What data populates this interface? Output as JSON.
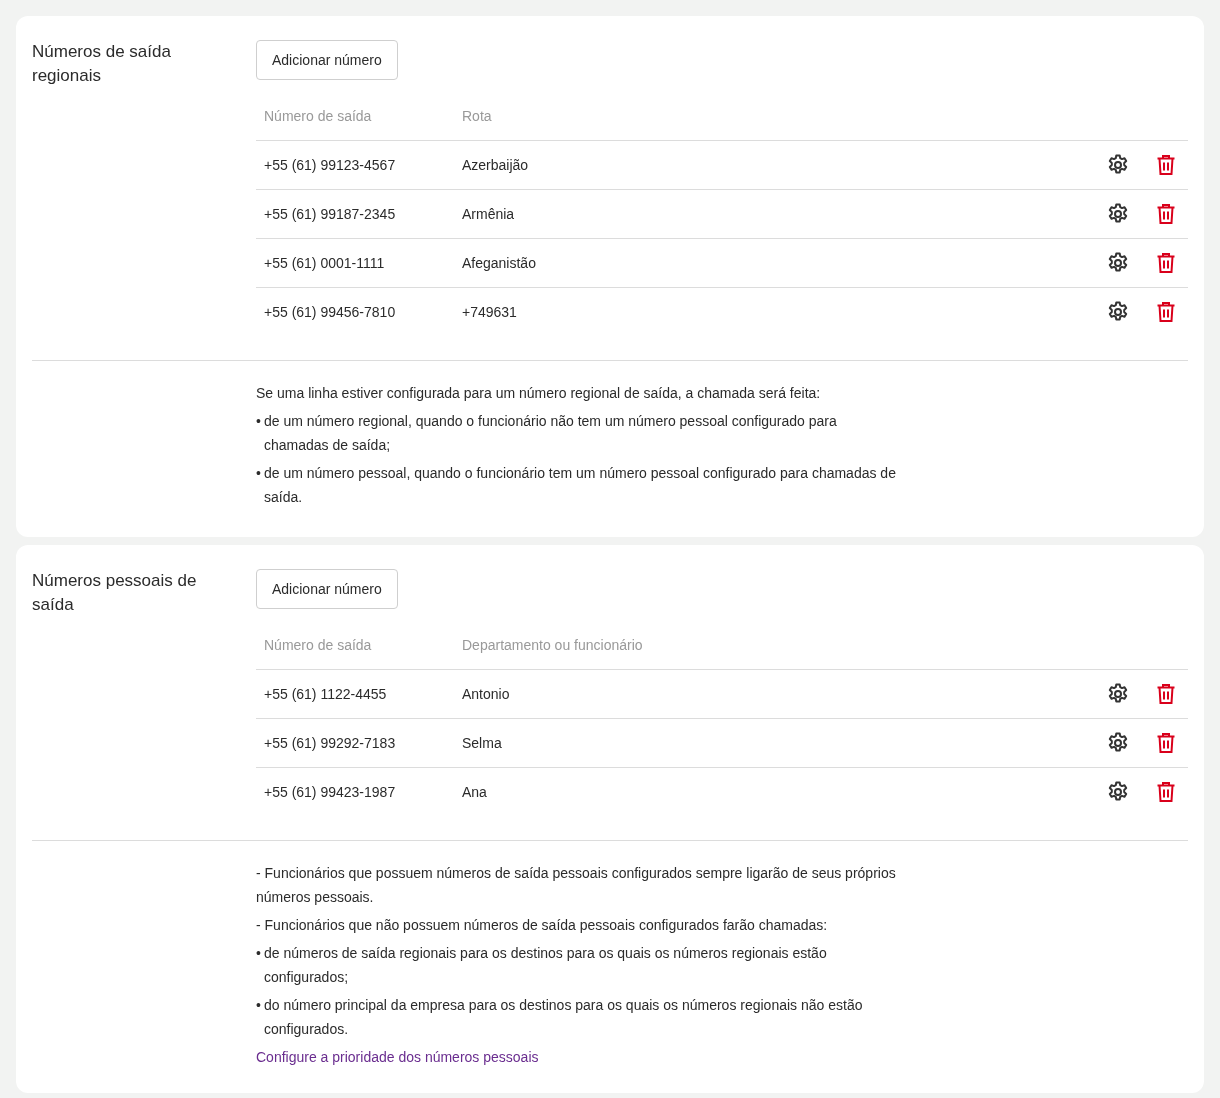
{
  "sections": [
    {
      "title": "Números de saída regionais",
      "add_button": "Adicionar número",
      "table": {
        "columns": [
          "Número de saída",
          "Rota"
        ],
        "rows": [
          {
            "number": "+55 (61) 99123-4567",
            "target": "Azerbaijão"
          },
          {
            "number": "+55 (61) 99187-2345",
            "target": "Armênia"
          },
          {
            "number": "+55 (61) 0001-1111",
            "target": "Afeganistão"
          },
          {
            "number": "+55 (61) 99456-7810",
            "target": "+749631"
          }
        ]
      },
      "notes": [
        {
          "kind": "para",
          "text": "Se uma linha estiver configurada para um número regional de saída, a chamada será feita:"
        },
        {
          "kind": "bullet",
          "marker": "•",
          "text": "de um número regional, quando o funcionário não tem um número pessoal configurado para chamadas de saída;"
        },
        {
          "kind": "bullet",
          "marker": "•",
          "text": "de um número pessoal, quando o funcionário tem um número pessoal configurado para chamadas de saída."
        }
      ]
    },
    {
      "title": "Números pessoais de saída",
      "add_button": "Adicionar número",
      "table": {
        "columns": [
          "Número de saída",
          "Departamento ou funcionário"
        ],
        "rows": [
          {
            "number": "+55 (61) 1122-4455",
            "target": "Antonio"
          },
          {
            "number": "+55 (61) 99292-7183",
            "target": "Selma"
          },
          {
            "number": "+55 (61) 99423-1987",
            "target": "Ana"
          }
        ]
      },
      "notes": [
        {
          "kind": "para",
          "text": "- Funcionários que possuem números de saída pessoais configurados sempre ligarão de seus próprios números pessoais."
        },
        {
          "kind": "para",
          "text": "- Funcionários que não possuem números de saída pessoais configurados farão chamadas:"
        },
        {
          "kind": "bullet",
          "marker": "•",
          "text": "de números de saída regionais para os destinos para os quais os números regionais estão configurados;"
        },
        {
          "kind": "bullet",
          "marker": "•",
          "text": "do número principal da empresa para os destinos para os quais os números regionais não estão configurados."
        },
        {
          "kind": "link",
          "text": "Configure a prioridade dos números pessoais"
        }
      ]
    }
  ]
}
